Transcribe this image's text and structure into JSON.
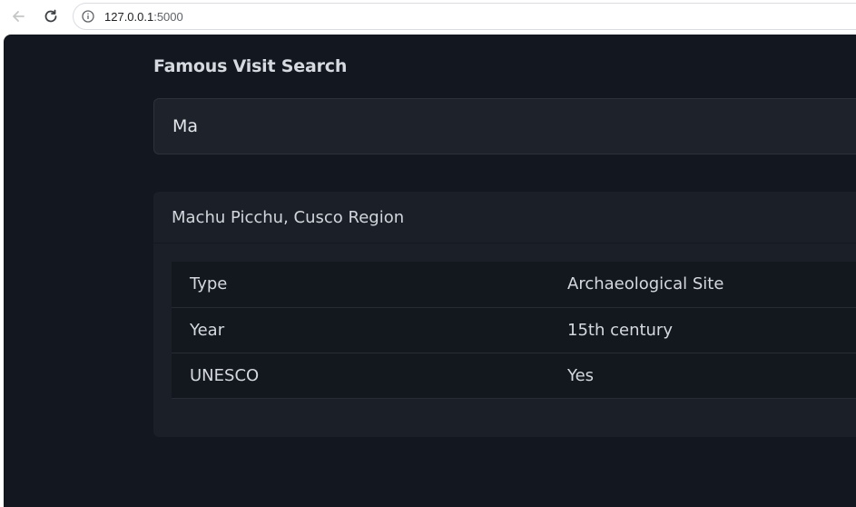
{
  "browser": {
    "url_host": "127.0.0.1",
    "url_port": ":5000"
  },
  "page": {
    "title": "Famous Visit Search",
    "search": {
      "value": "Ma"
    },
    "result": {
      "title": "Machu Picchu, Cusco Region",
      "rows": [
        {
          "key": "Type",
          "value": "Archaeological Site"
        },
        {
          "key": "Year",
          "value": "15th century"
        },
        {
          "key": "UNESCO",
          "value": "Yes"
        }
      ]
    }
  }
}
